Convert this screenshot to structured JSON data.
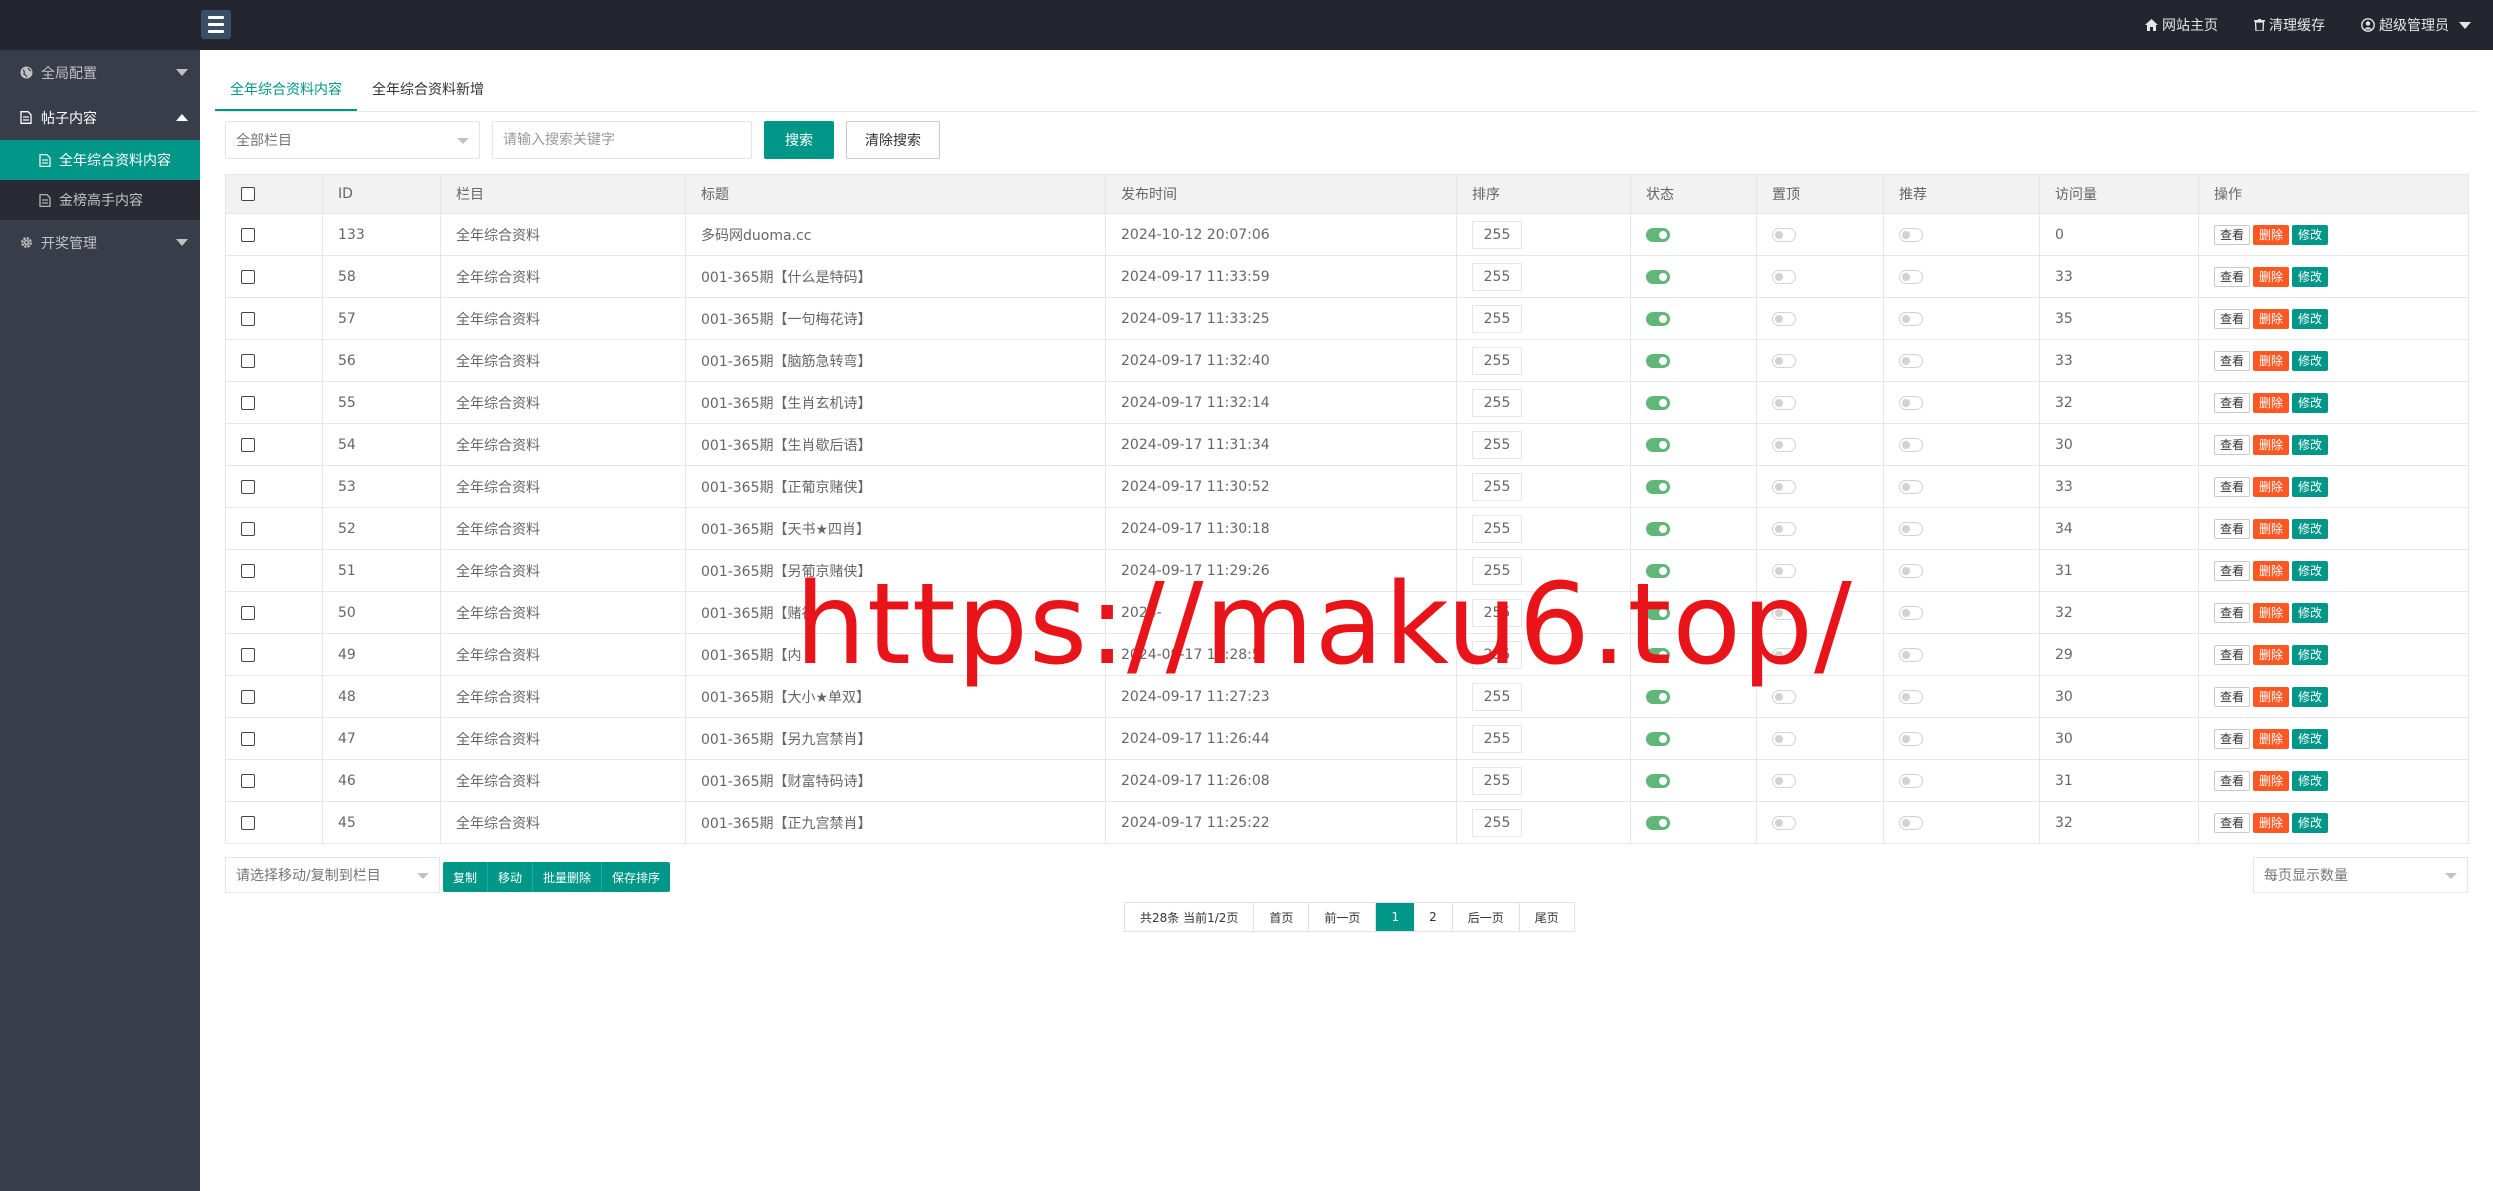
{
  "header": {
    "home_label": "网站主页",
    "clear_cache_label": "清理缓存",
    "admin_label": "超级管理员"
  },
  "sidebar": {
    "items": [
      {
        "label": "全局配置",
        "icon": "globe-icon",
        "expanded": false
      },
      {
        "label": "帖子内容",
        "icon": "doc-icon",
        "expanded": true,
        "children": [
          {
            "label": "全年综合资料内容",
            "active": true
          },
          {
            "label": "金榜高手内容",
            "active": false
          }
        ]
      },
      {
        "label": "开奖管理",
        "icon": "gear-icon",
        "expanded": false
      }
    ]
  },
  "tabs": [
    {
      "label": "全年综合资料内容",
      "active": true
    },
    {
      "label": "全年综合资料新增",
      "active": false
    }
  ],
  "search": {
    "category_value": "全部栏目",
    "keyword_placeholder": "请输入搜索关键字",
    "search_label": "搜索",
    "clear_label": "清除搜索"
  },
  "table": {
    "columns": [
      "ID",
      "栏目",
      "标题",
      "发布时间",
      "排序",
      "状态",
      "置顶",
      "推荐",
      "访问量",
      "操作"
    ],
    "rows": [
      {
        "id": "133",
        "category": "全年综合资料",
        "title": "多码网duoma.cc",
        "time": "2024-10-12 20:07:06",
        "sort": "255",
        "status": true,
        "top": false,
        "recommend": false,
        "views": "0"
      },
      {
        "id": "58",
        "category": "全年综合资料",
        "title": "001-365期【什么是特码】",
        "time": "2024-09-17 11:33:59",
        "sort": "255",
        "status": true,
        "top": false,
        "recommend": false,
        "views": "33"
      },
      {
        "id": "57",
        "category": "全年综合资料",
        "title": "001-365期【一句梅花诗】",
        "time": "2024-09-17 11:33:25",
        "sort": "255",
        "status": true,
        "top": false,
        "recommend": false,
        "views": "35"
      },
      {
        "id": "56",
        "category": "全年综合资料",
        "title": "001-365期【脑筋急转弯】",
        "time": "2024-09-17 11:32:40",
        "sort": "255",
        "status": true,
        "top": false,
        "recommend": false,
        "views": "33"
      },
      {
        "id": "55",
        "category": "全年综合资料",
        "title": "001-365期【生肖玄机诗】",
        "time": "2024-09-17 11:32:14",
        "sort": "255",
        "status": true,
        "top": false,
        "recommend": false,
        "views": "32"
      },
      {
        "id": "54",
        "category": "全年综合资料",
        "title": "001-365期【生肖歇后语】",
        "time": "2024-09-17 11:31:34",
        "sort": "255",
        "status": true,
        "top": false,
        "recommend": false,
        "views": "30"
      },
      {
        "id": "53",
        "category": "全年综合资料",
        "title": "001-365期【正葡京赌侠】",
        "time": "2024-09-17 11:30:52",
        "sort": "255",
        "status": true,
        "top": false,
        "recommend": false,
        "views": "33"
      },
      {
        "id": "52",
        "category": "全年综合资料",
        "title": "001-365期【天书★四肖】",
        "time": "2024-09-17 11:30:18",
        "sort": "255",
        "status": true,
        "top": false,
        "recommend": false,
        "views": "34"
      },
      {
        "id": "51",
        "category": "全年综合资料",
        "title": "001-365期【另葡京赌侠】",
        "time": "2024-09-17 11:29:26",
        "sort": "255",
        "status": true,
        "top": false,
        "recommend": false,
        "views": "31"
      },
      {
        "id": "50",
        "category": "全年综合资料",
        "title": "001-365期【赌神",
        "time": "2024-",
        "sort": "255",
        "status": true,
        "top": false,
        "recommend": false,
        "views": "32"
      },
      {
        "id": "49",
        "category": "全年综合资料",
        "title": "001-365期【内",
        "time": "2024-09-17 11:28:5",
        "sort": "255",
        "status": true,
        "top": false,
        "recommend": false,
        "views": "29"
      },
      {
        "id": "48",
        "category": "全年综合资料",
        "title": "001-365期【大小★单双】",
        "time": "2024-09-17 11:27:23",
        "sort": "255",
        "status": true,
        "top": false,
        "recommend": false,
        "views": "30"
      },
      {
        "id": "47",
        "category": "全年综合资料",
        "title": "001-365期【另九宫禁肖】",
        "time": "2024-09-17 11:26:44",
        "sort": "255",
        "status": true,
        "top": false,
        "recommend": false,
        "views": "30"
      },
      {
        "id": "46",
        "category": "全年综合资料",
        "title": "001-365期【财富特码诗】",
        "time": "2024-09-17 11:26:08",
        "sort": "255",
        "status": true,
        "top": false,
        "recommend": false,
        "views": "31"
      },
      {
        "id": "45",
        "category": "全年综合资料",
        "title": "001-365期【正九宫禁肖】",
        "time": "2024-09-17 11:25:22",
        "sort": "255",
        "status": true,
        "top": false,
        "recommend": false,
        "views": "32"
      }
    ],
    "actions": {
      "view": "查看",
      "delete": "删除",
      "edit": "修改"
    }
  },
  "bulk": {
    "move_select_placeholder": "请选择移动/复制到栏目",
    "copy_label": "复制",
    "move_label": "移动",
    "batch_delete_label": "批量删除",
    "save_sort_label": "保存排序",
    "per_page_placeholder": "每页显示数量"
  },
  "pagination": {
    "info": "共28条 当前1/2页",
    "first": "首页",
    "prev": "前一页",
    "pages": [
      "1",
      "2"
    ],
    "current": "1",
    "next": "后一页",
    "last": "尾页"
  },
  "watermark": "https://maku6.top/",
  "colors": {
    "topbar": "#23262e",
    "sidebar": "#393d49",
    "accent": "#009688",
    "danger": "#FF5722",
    "switch_on": "#5FB878",
    "watermark": "#e8141a"
  }
}
